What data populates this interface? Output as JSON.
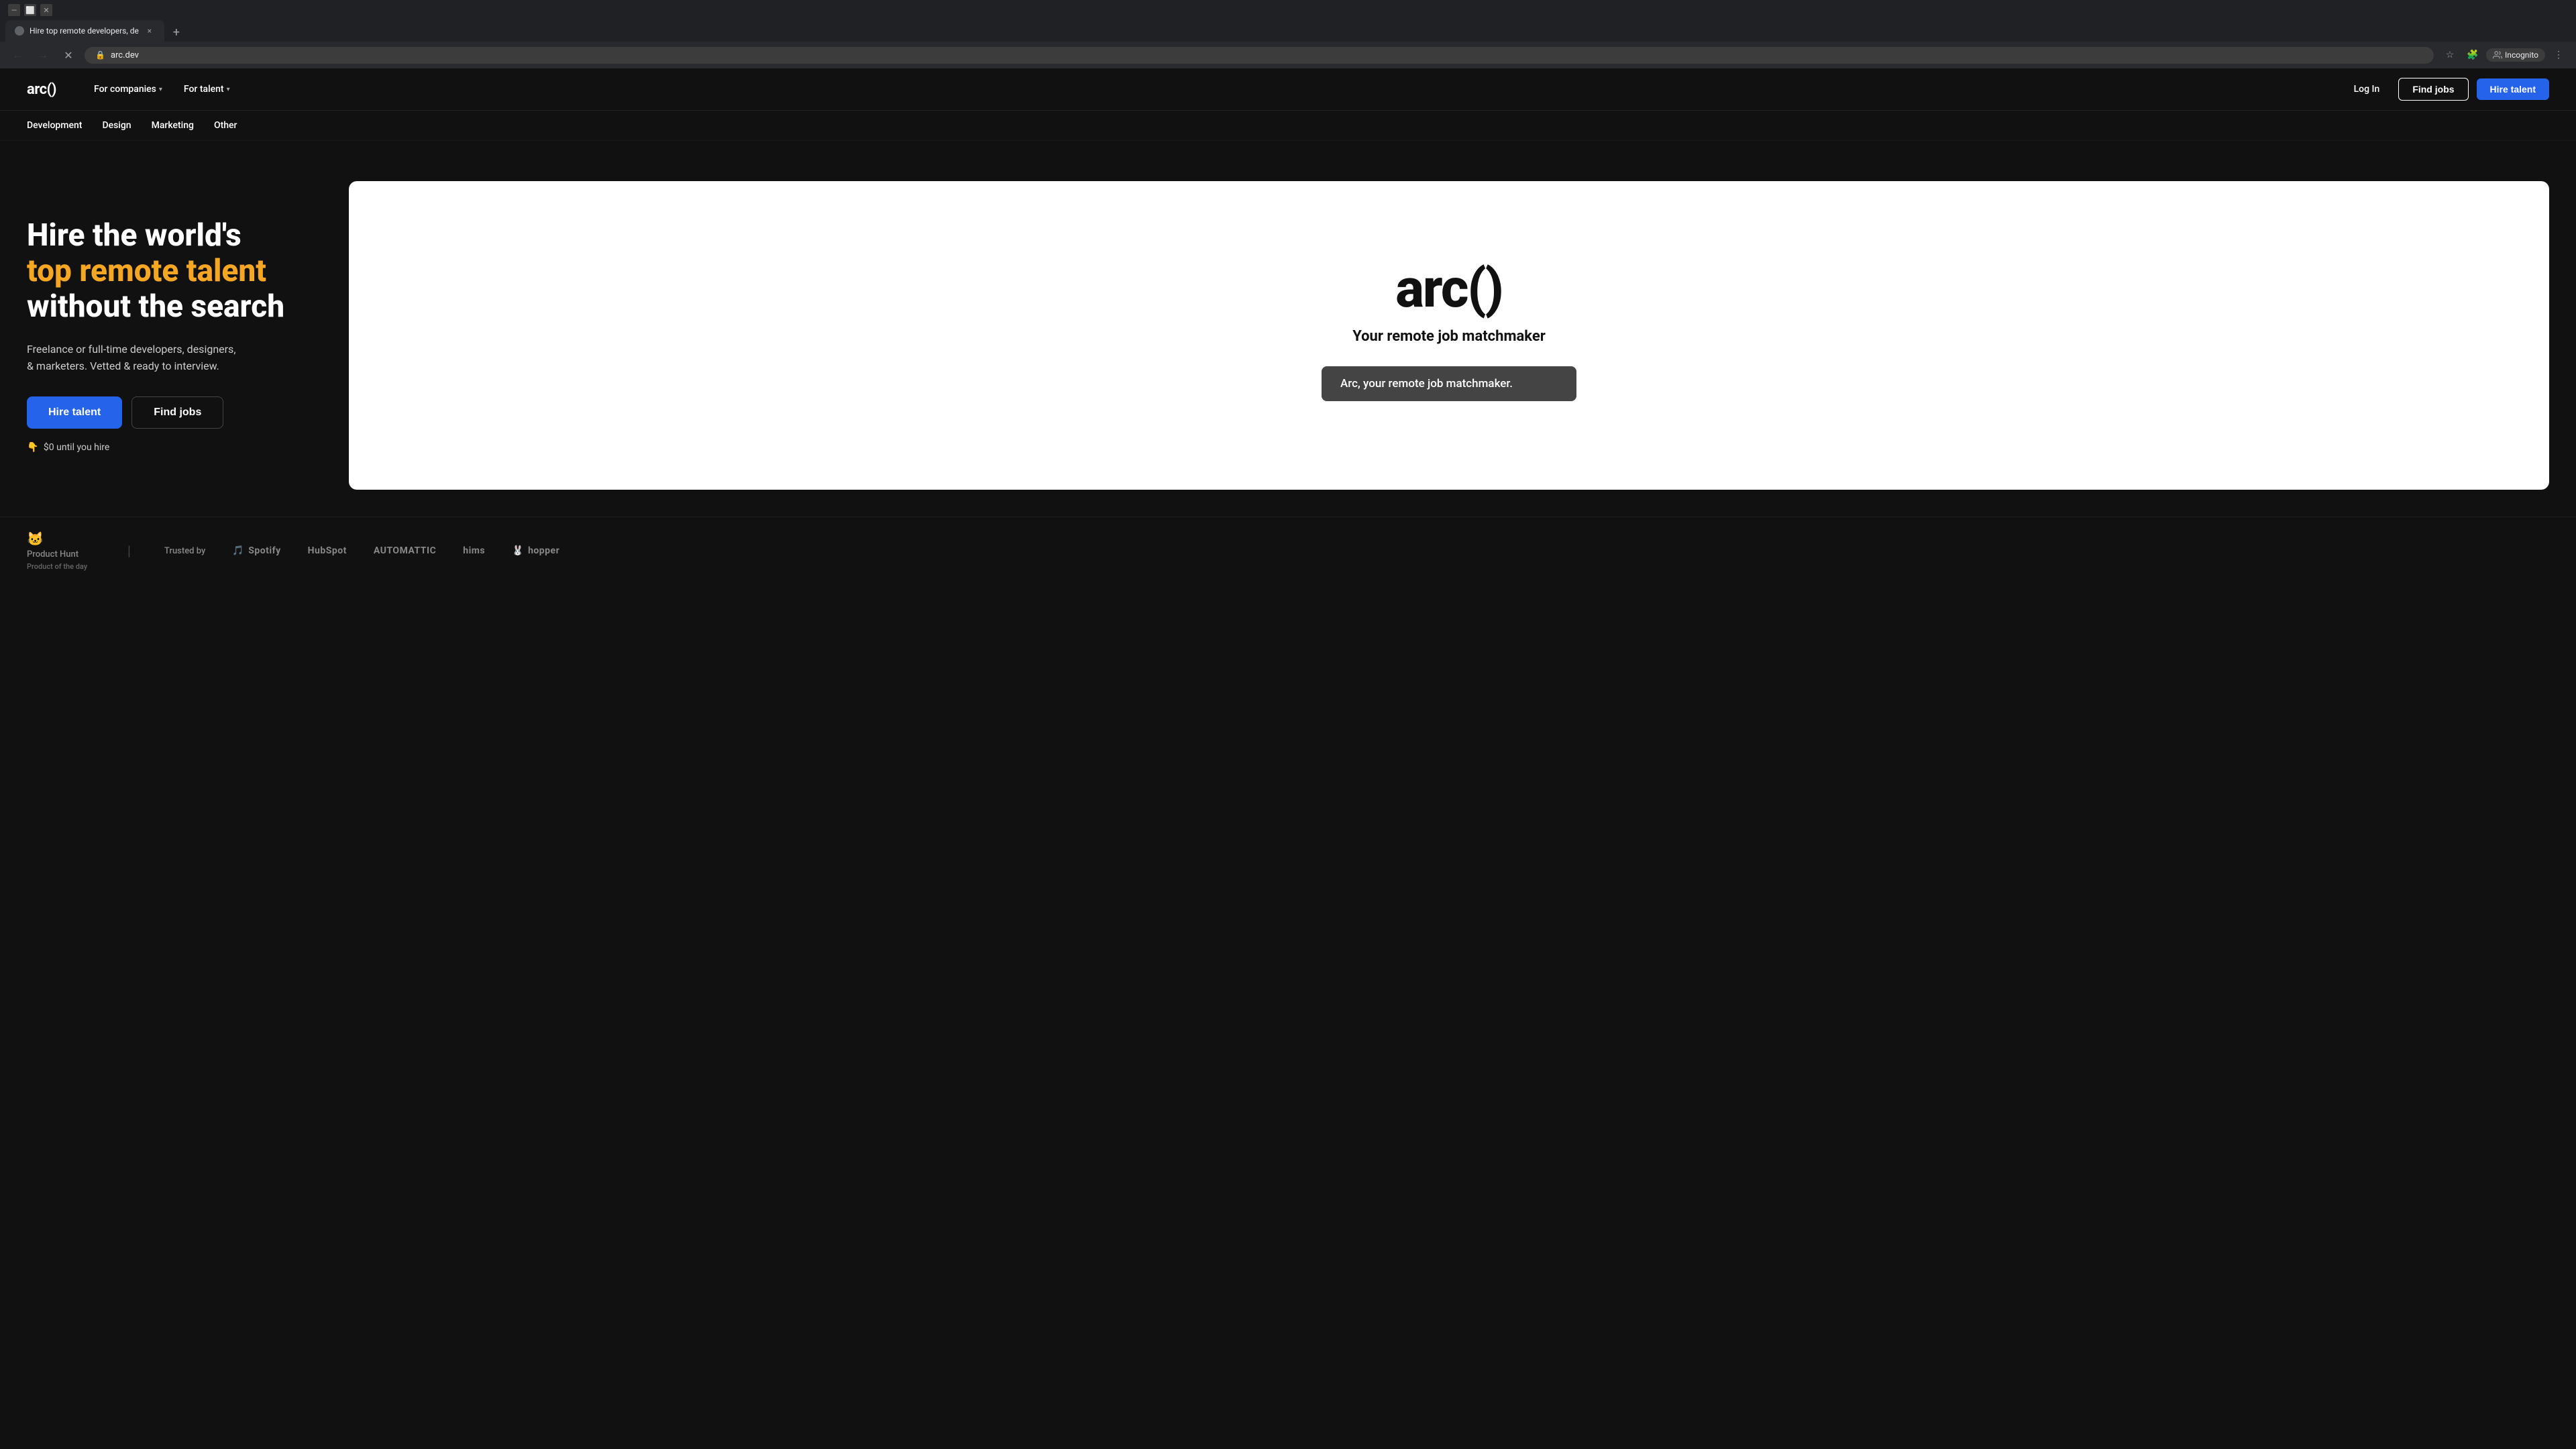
{
  "browser": {
    "tab_title": "Hire top remote developers, de",
    "tab_close": "×",
    "tab_new": "+",
    "nav_back": "←",
    "nav_forward": "→",
    "nav_reload": "✕",
    "url": "arc.dev",
    "url_icon": "🔒",
    "bookmark_icon": "☆",
    "extensions_icon": "🧩",
    "incognito_label": "Incognito",
    "menu_icon": "⋮"
  },
  "nav": {
    "logo": "arc()",
    "for_companies_label": "For companies",
    "for_talent_label": "For talent",
    "login_label": "Log In",
    "find_jobs_label": "Find jobs",
    "hire_talent_label": "Hire talent"
  },
  "sub_nav": {
    "items": [
      "Development",
      "Design",
      "Marketing",
      "Other"
    ]
  },
  "hero": {
    "title_line1": "Hire the world's",
    "title_highlight": "top remote talent",
    "title_line3": "without the search",
    "description": "Freelance or full-time developers, designers,\n& marketers. Vetted & ready to interview.",
    "cta_hire": "Hire talent",
    "cta_find": "Find jobs",
    "note_emoji": "👇",
    "note_text": "$0 until you hire"
  },
  "preview": {
    "logo": "arc()",
    "tagline": "Your remote job matchmaker",
    "input_text": "Arc, your remote job matchmaker."
  },
  "trusted": {
    "product_hunt_icon": "🐱",
    "product_hunt_label": "Product Hunt",
    "product_hunt_sublabel": "Product of the day",
    "trusted_by_label": "Trusted by",
    "logos": [
      "Spotify",
      "HubSpot",
      "AUTOMATTIC",
      "hims",
      "hopper"
    ]
  }
}
